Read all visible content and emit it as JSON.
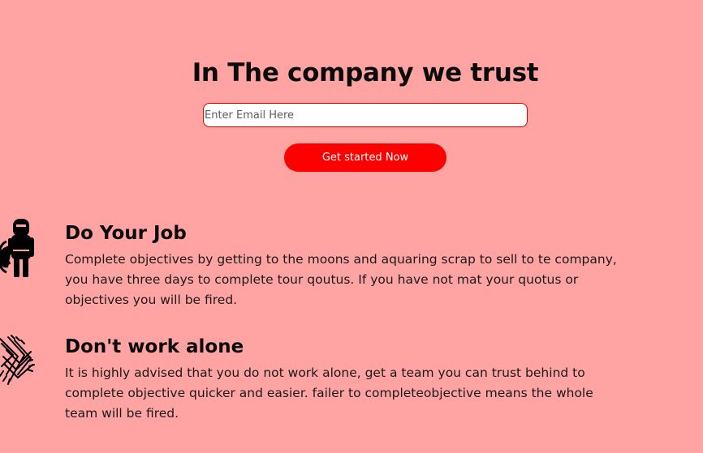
{
  "hero": {
    "title": "In The company we trust",
    "email_placeholder": "Enter Email Here",
    "cta_label": "Get started Now"
  },
  "features": [
    {
      "icon": "hazmat-worker-icon",
      "title": "Do Your Job",
      "text": "Complete objectives by getting to the moons and aquaring scrap to sell to te company, you have three days to complete tour qoutus. If you have not mat your quotus or objectives you will be fired."
    },
    {
      "icon": "team-hands-icon",
      "title": "Don't work alone",
      "text": "It is highly advised that you do not work alone, get a team you can trust behind to complete objective quicker and easier. failer to completeobjective means the whole team will be fired."
    }
  ],
  "colors": {
    "background": "#ffa3a3",
    "accent": "#ff0000",
    "input_border": "#e30000"
  }
}
